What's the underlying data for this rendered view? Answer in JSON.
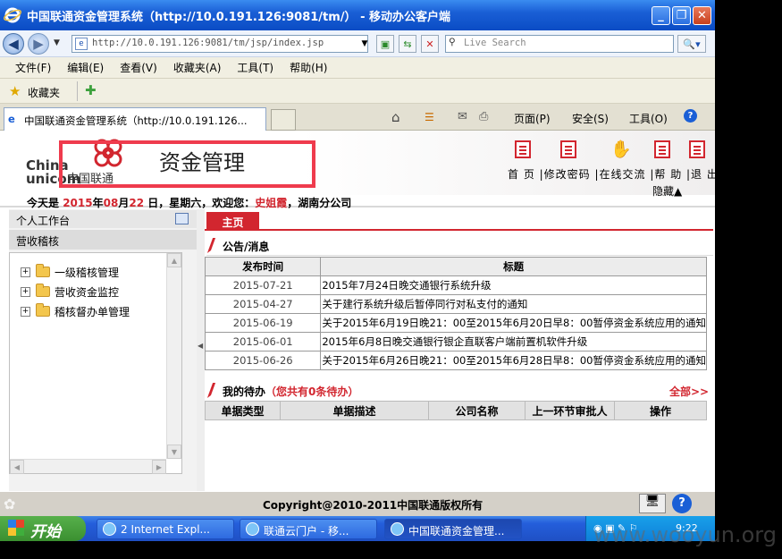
{
  "window": {
    "title": "中国联通资金管理系统（http://10.0.191.126:9081/tm/） - 移动办公客户端",
    "min": "_",
    "max": "❐",
    "close": "✕"
  },
  "addressbar": {
    "url": "http://10.0.191.126:9081/tm/jsp/index.jsp",
    "search_placeholder": "Live Search"
  },
  "menu": [
    "文件(F)",
    "编辑(E)",
    "查看(V)",
    "收藏夹(A)",
    "工具(T)",
    "帮助(H)"
  ],
  "favorites_label": "收藏夹",
  "tab": {
    "label": "中国联通资金管理系统（http://10.0.191.126...",
    "cmd_page": "页面(P)",
    "cmd_safety": "安全(S)",
    "cmd_tools": "工具(O)"
  },
  "header": {
    "logo_china": "China",
    "logo_unicom": "unicom",
    "logo_cn": "中国联通",
    "title": "资金管理",
    "links": "首 页  |修改密码 |在线交流 |帮 助 |退 出",
    "hide": "隐藏▲"
  },
  "info": {
    "prefix": "今天是",
    "year": "2015",
    "y": "年",
    "month": "08",
    "m": "月",
    "day": "22",
    "d": "日，星期六，欢迎您：",
    "user": "史姐霞",
    "org": "，湖南分公司"
  },
  "sidebar": {
    "workbench": "个人工作台",
    "section": "营收稽核",
    "items": [
      {
        "label": "一级稽核管理"
      },
      {
        "label": "营收资金监控"
      },
      {
        "label": "稽核督办单管理"
      }
    ]
  },
  "main": {
    "home_tab": "主页",
    "notice_title": "公告/消息",
    "notice_cols": [
      "发布时间",
      "标题"
    ],
    "notices": [
      {
        "date": "2015-07-21",
        "title": "2015年7月24日晚交通银行系统升级"
      },
      {
        "date": "2015-04-27",
        "title": "关于建行系统升级后暂停同行对私支付的通知"
      },
      {
        "date": "2015-06-19",
        "title": "关于2015年6月19日晚21：00至2015年6月20日早8：00暂停资金系统应用的通知"
      },
      {
        "date": "2015-06-01",
        "title": "2015年6月8日晚交通银行银企直联客户端前置机软件升级"
      },
      {
        "date": "2015-06-26",
        "title": "关于2015年6月26日晚21：00至2015年6月28日早8：00暂停资金系统应用的通知"
      }
    ],
    "todo_title": "我的待办",
    "todo_count": "（您共有0条待办）",
    "todo_all": "全部>>",
    "todo_cols": [
      "单据类型",
      "单据描述",
      "公司名称",
      "上一环节审批人",
      "操作"
    ]
  },
  "footer": {
    "copyright": "Copyright@2010-2011中国联通版权所有"
  },
  "taskbar": {
    "start": "开始",
    "buttons": [
      "2 Internet Expl...",
      "联通云门户 - 移...",
      "中国联通资金管理..."
    ],
    "clock": "9:22"
  },
  "watermark": "www.wooyun.org",
  "colors": {
    "accent": "#d2262f",
    "titlebar": "#1a5fd6"
  }
}
